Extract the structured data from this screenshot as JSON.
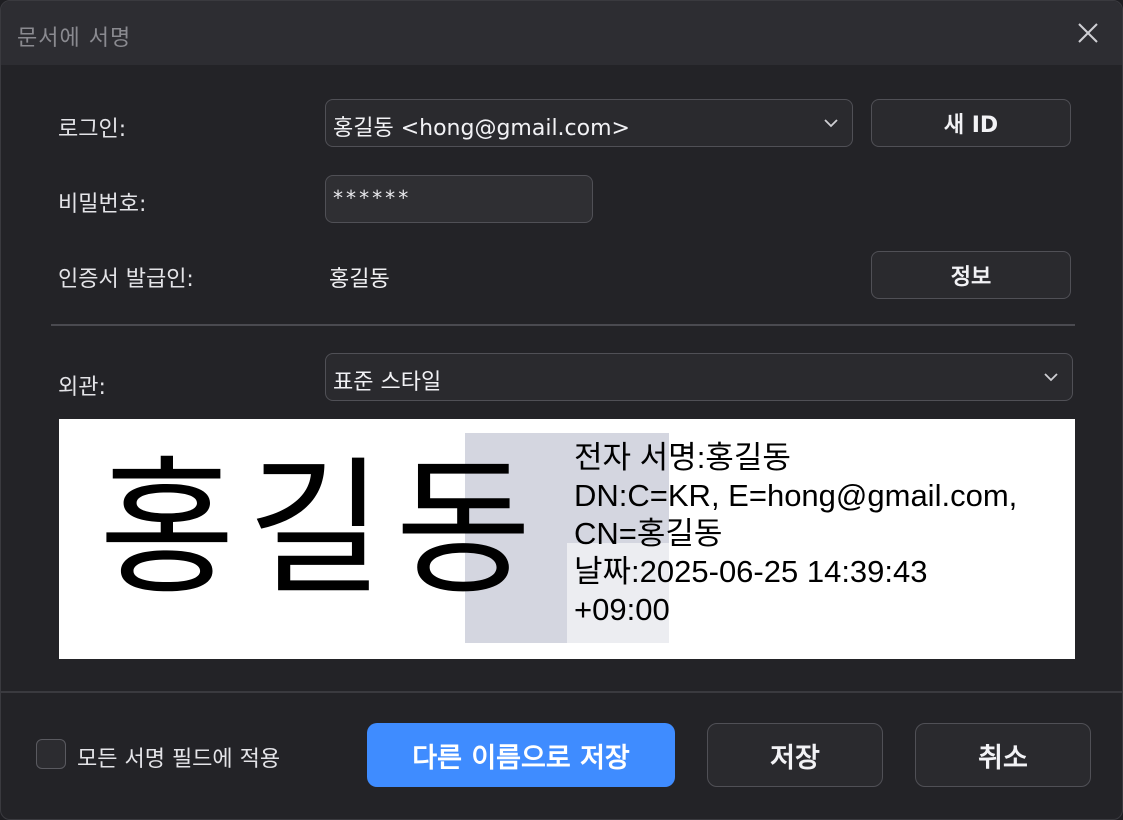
{
  "dialog": {
    "title": "문서에 서명"
  },
  "login": {
    "label": "로그인:",
    "selected": "홍길동 <hong@gmail.com>",
    "new_id_button": "새 ID"
  },
  "password": {
    "label": "비밀번호:",
    "value": "******"
  },
  "issuer": {
    "label": "인증서 발급인:",
    "value": "홍길동",
    "info_button": "정보"
  },
  "appearance": {
    "label": "외관:",
    "selected": "표준 스타일"
  },
  "preview": {
    "signature_name": "홍길동",
    "info_lines": [
      "전자 서명:홍길동",
      "DN:C=KR, E=hong@gmail.com,",
      "CN=홍길동",
      "날짜:2025-06-25 14:39:43",
      "+09:00"
    ]
  },
  "footer": {
    "apply_all_label": "모든 서명 필드에 적용",
    "apply_all_checked": false,
    "save_as_button": "다른 이름으로 저장",
    "save_button": "저장",
    "cancel_button": "취소"
  },
  "colors": {
    "primary": "#3f8cff",
    "background": "#232327",
    "titlebar": "#2d2d32"
  },
  "icons": {
    "close": "close-icon",
    "dropdown": "chevron-down-icon",
    "checkbox": "checkbox-unchecked-icon"
  }
}
